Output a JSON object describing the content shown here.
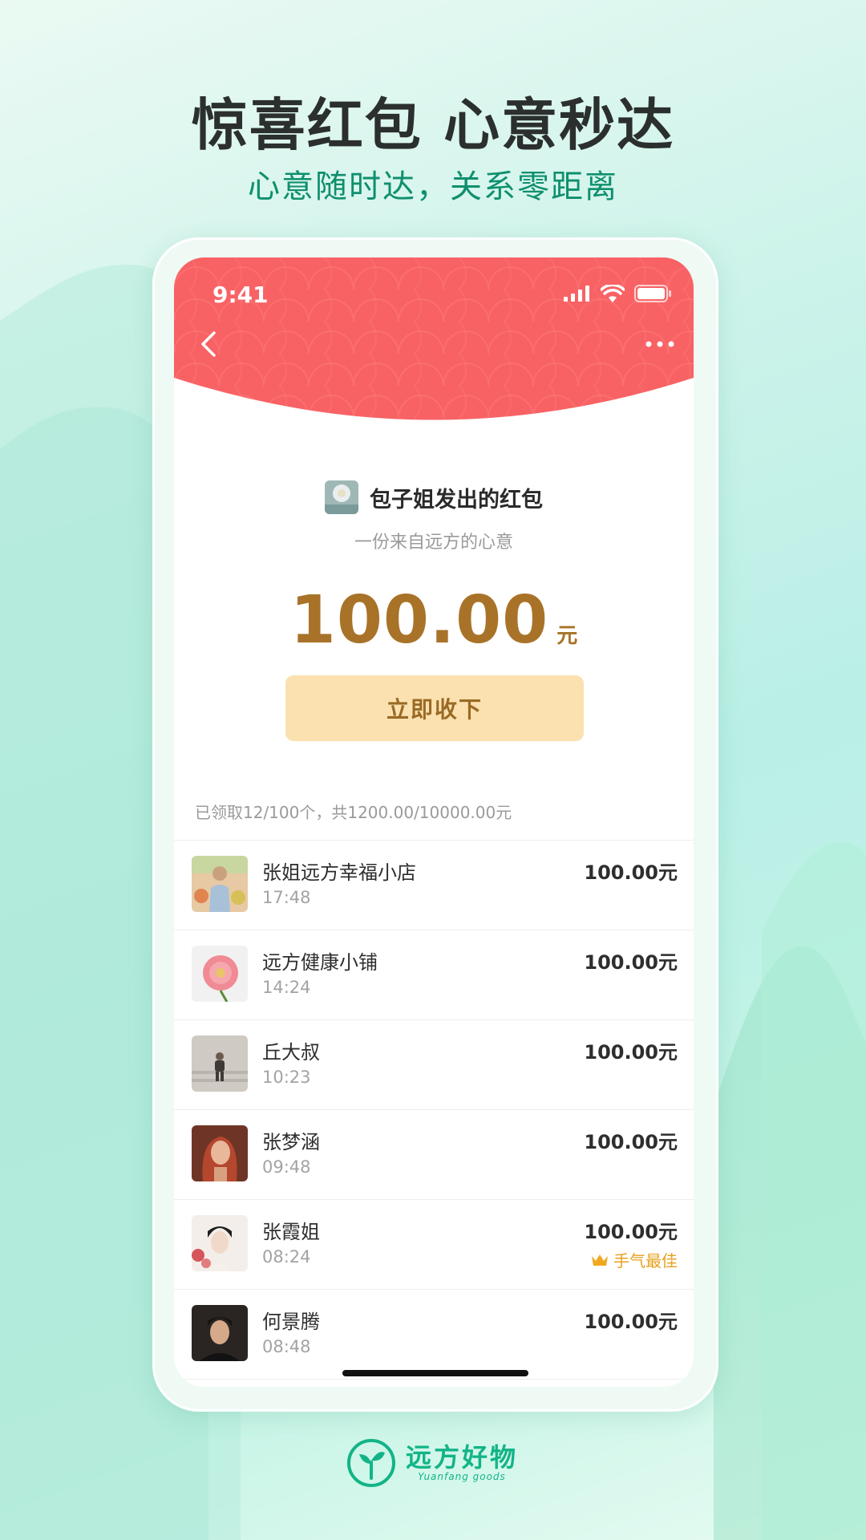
{
  "promo": {
    "title": "惊喜红包 心意秒达",
    "subtitle": "心意随时达，关系零距离"
  },
  "status_bar": {
    "time": "9:41"
  },
  "envelope": {
    "sender_title": "包子姐发出的红包",
    "blessing": "一份来自远方的心意",
    "amount": "100.00",
    "amount_unit": "元",
    "accept_label": "立即收下",
    "summary": "已领取12/100个，共1200.00/10000.00元"
  },
  "recipients": [
    {
      "name": "张姐远方幸福小店",
      "time": "17:48",
      "amount": "100.00元",
      "avatar": "woman-market-avatar"
    },
    {
      "name": "远方健康小铺",
      "time": "14:24",
      "amount": "100.00元",
      "avatar": "peony-flower-avatar"
    },
    {
      "name": "丘大叔",
      "time": "10:23",
      "amount": "100.00元",
      "avatar": "person-steps-avatar"
    },
    {
      "name": "张梦涵",
      "time": "09:48",
      "amount": "100.00元",
      "avatar": "red-hair-woman-avatar"
    },
    {
      "name": "张霞姐",
      "time": "08:24",
      "amount": "100.00元",
      "best_label": "手气最佳",
      "avatar": "traditional-woman-avatar"
    },
    {
      "name": "何景腾",
      "time": "08:48",
      "amount": "100.00元",
      "avatar": "man-portrait-avatar"
    }
  ],
  "brand": {
    "name": "远方好物",
    "sub": "Yuanfang goods"
  },
  "colors": {
    "hero_red": "#f86264",
    "amount_gold": "#a87328",
    "accept_bg": "#fbe1b0",
    "brand_green": "#12b487",
    "best_orange": "#e7a01d"
  }
}
